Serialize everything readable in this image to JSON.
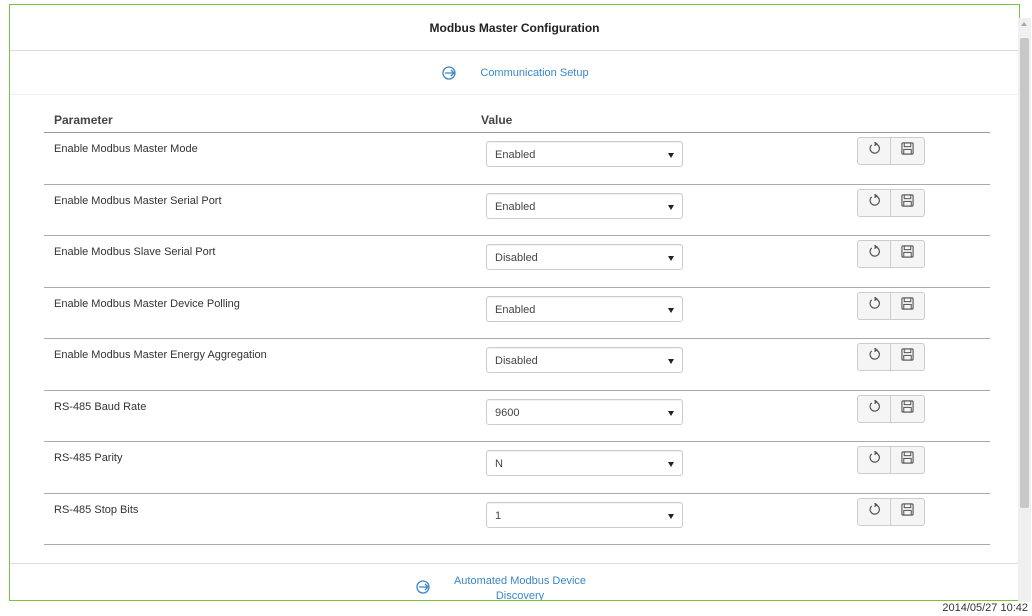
{
  "panel": {
    "title": "Modbus Master Configuration"
  },
  "section": {
    "link_label": "Communication Setup",
    "icon": "circle-arrow-right-icon"
  },
  "table": {
    "headers": [
      "Parameter",
      "Value"
    ],
    "rows": [
      {
        "parameter": "Enable Modbus Master Mode",
        "value": "Enabled"
      },
      {
        "parameter": "Enable Modbus Master Serial Port",
        "value": "Enabled"
      },
      {
        "parameter": "Enable Modbus Slave Serial Port",
        "value": "Disabled"
      },
      {
        "parameter": "Enable Modbus Master Device Polling",
        "value": "Enabled"
      },
      {
        "parameter": "Enable Modbus Master Energy Aggregation",
        "value": "Disabled"
      },
      {
        "parameter": "RS-485 Baud Rate",
        "value": "9600"
      },
      {
        "parameter": "RS-485 Parity",
        "value": "N"
      },
      {
        "parameter": "RS-485 Stop Bits",
        "value": "1"
      }
    ],
    "row_actions": [
      "refresh-icon",
      "save-icon"
    ]
  },
  "footer": {
    "link_label": "Automated Modbus Device Discovery",
    "icon": "circle-arrow-right-icon"
  },
  "status": {
    "timestamp": "2014/05/27 10:42"
  },
  "colors": {
    "accent_border": "#7cc242",
    "link": "#3a87c8"
  }
}
